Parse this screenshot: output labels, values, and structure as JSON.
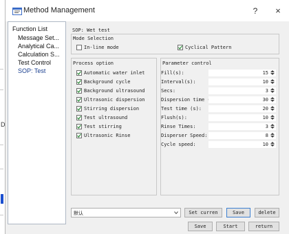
{
  "window": {
    "title": "Method Management",
    "help_glyph": "?",
    "close_glyph": "×"
  },
  "background": {
    "left_char": "D"
  },
  "function_list": {
    "header": "Function List",
    "items": [
      {
        "label": "Message Set..."
      },
      {
        "label": "Analytical Ca..."
      },
      {
        "label": "Calculation S..."
      },
      {
        "label": "Test Control"
      },
      {
        "label": "SOP: Test",
        "selected": true
      }
    ]
  },
  "sop": {
    "label": "SOP: Wet test"
  },
  "mode_selection": {
    "title": "Mode Selection",
    "inline": {
      "label": "In-line mode",
      "checked": false
    },
    "cyclical": {
      "label": "Cyclical Pattern",
      "checked": true
    }
  },
  "process_option": {
    "title": "Process option",
    "items": [
      {
        "label": "Automatic water inlet",
        "checked": true
      },
      {
        "label": "Background cycle",
        "checked": true
      },
      {
        "label": "Background ultrasound",
        "checked": true
      },
      {
        "label": "Ultrasonic dispersion",
        "checked": true
      },
      {
        "label": "Stirring dispersion",
        "checked": true
      },
      {
        "label": "Test ultrasound",
        "checked": true
      },
      {
        "label": "Test stirring",
        "checked": true
      },
      {
        "label": "Ultrasonic Rinse",
        "checked": true
      }
    ]
  },
  "parameter_control": {
    "title": "Parameter control",
    "params": [
      {
        "label": "Fill(s):",
        "value": "15"
      },
      {
        "label": "Interval(s):",
        "value": "10"
      },
      {
        "label": "Secs:",
        "value": "3"
      },
      {
        "label": "Dispersion time (s):",
        "value": "30"
      },
      {
        "label": "Test time (s):",
        "value": "20"
      },
      {
        "label": "Flush(s):",
        "value": "10"
      },
      {
        "label": "Rinse Times:",
        "value": "3"
      },
      {
        "label": "Disperser Speed:",
        "value": "8"
      },
      {
        "label": "Cycle speed:",
        "value": "10"
      }
    ]
  },
  "bottom": {
    "combo_value": "默认",
    "set_current": "Set curren",
    "save": "Save",
    "delete": "delete"
  },
  "footer": {
    "save": "Save",
    "start": "Start",
    "return": "return"
  },
  "colors": {
    "selected_text": "#1a3f8f",
    "default_button_border": "#3c7fd1",
    "check_green": "#2e8b3a"
  }
}
